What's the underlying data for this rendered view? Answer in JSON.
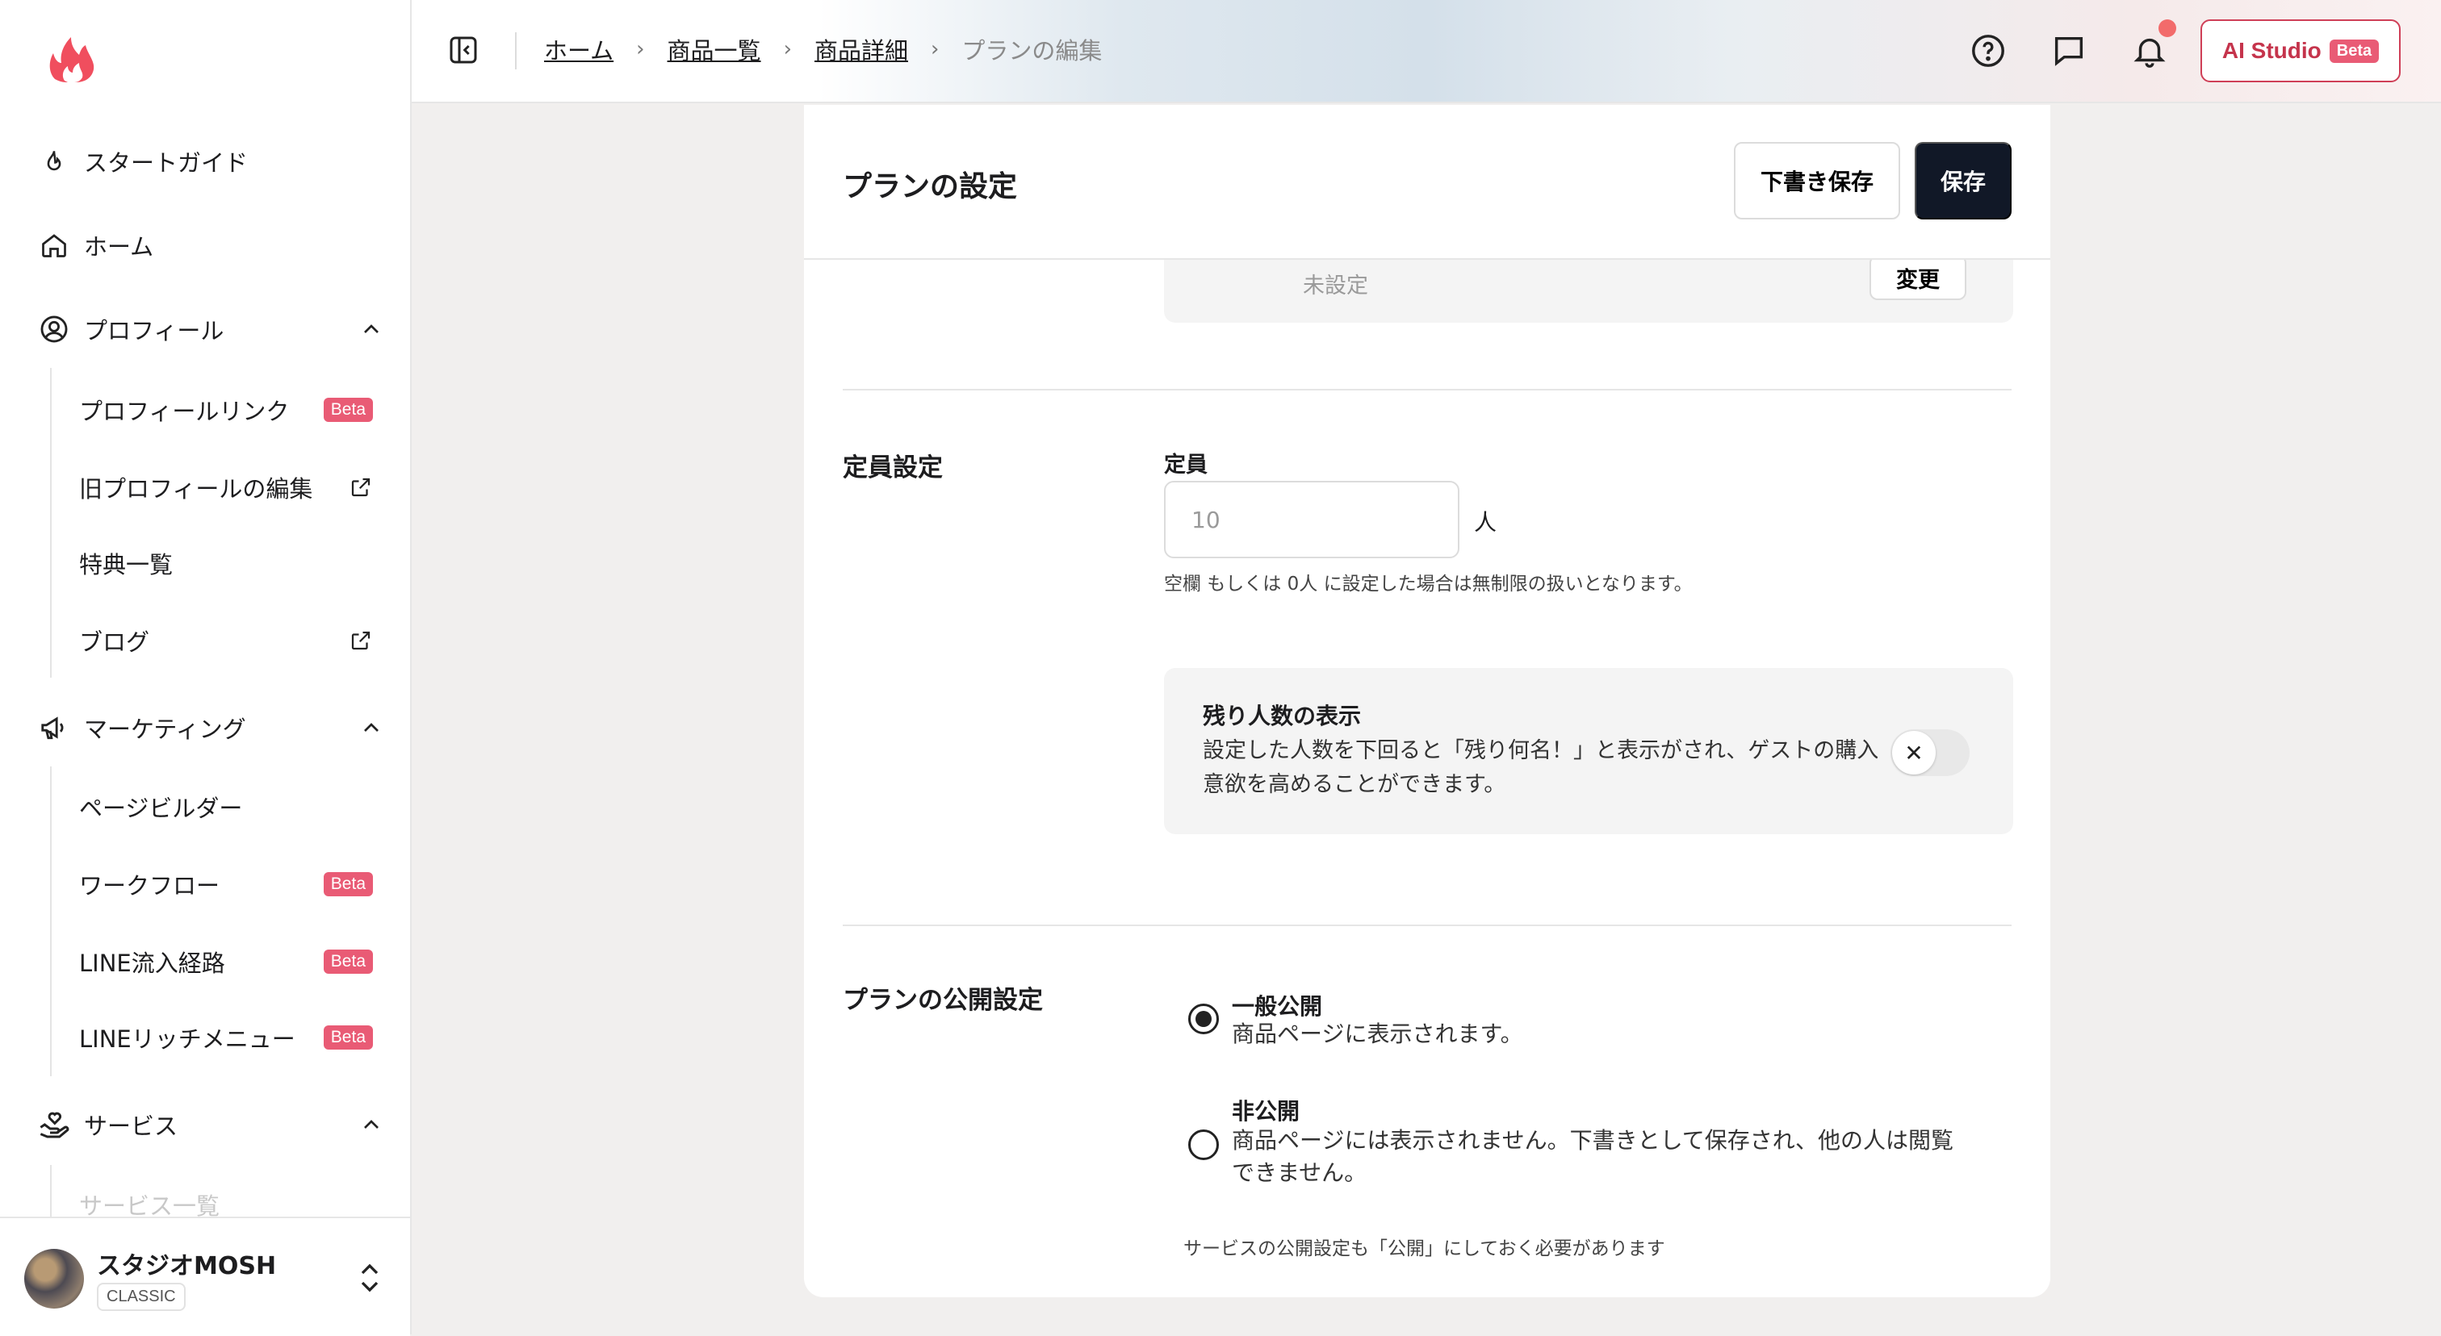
{
  "sidebar": {
    "items": [
      {
        "label": "スタートガイド",
        "icon": "flame-icon"
      },
      {
        "label": "ホーム",
        "icon": "home-icon"
      },
      {
        "label": "プロフィール",
        "icon": "user-circle-icon"
      },
      {
        "label": "マーケティング",
        "icon": "megaphone-icon"
      },
      {
        "label": "サービス",
        "icon": "hand-heart-icon"
      }
    ],
    "profile_sub": [
      {
        "label": "プロフィールリンク",
        "badge": "Beta"
      },
      {
        "label": "旧プロフィールの編集",
        "icon": "external-link-icon"
      },
      {
        "label": "特典一覧"
      },
      {
        "label": "ブログ",
        "icon": "external-link-icon"
      }
    ],
    "marketing_sub": [
      {
        "label": "ページビルダー"
      },
      {
        "label": "ワークフロー",
        "badge": "Beta"
      },
      {
        "label": "LINE流入経路",
        "badge": "Beta"
      },
      {
        "label": "LINEリッチメニュー",
        "badge": "Beta"
      }
    ],
    "service_sub": [
      {
        "label": "サービス一覧"
      }
    ],
    "user": {
      "name": "スタジオMOSH",
      "plan": "CLASSIC"
    }
  },
  "header": {
    "breadcrumb": [
      "ホーム",
      "商品一覧",
      "商品詳細"
    ],
    "breadcrumb_current": "プランの編集",
    "ai_studio_label": "AI Studio",
    "ai_studio_badge": "Beta"
  },
  "card": {
    "title": "プランの設定",
    "draft_label": "下書き保存",
    "save_label": "保存",
    "prev": {
      "value": "未設定",
      "change_label": "変更"
    }
  },
  "capacity": {
    "section_label": "定員設定",
    "field_label": "定員",
    "placeholder": "10",
    "unit": "人",
    "help": "空欄 もしくは 0人 に設定した場合は無制限の扱いとなります。",
    "remain_title": "残り人数の表示",
    "remain_desc": "設定した人数を下回ると「残り何名！」と表示がされ、ゲストの購入意欲を高めることができます。",
    "remain_toggle_on": false
  },
  "visibility": {
    "section_label": "プランの公開設定",
    "options": [
      {
        "title": "一般公開",
        "desc": "商品ページに表示されます。",
        "checked": true
      },
      {
        "title": "非公開",
        "desc": "商品ページには表示されません。下書きとして保存され、他の人は閲覧できません。",
        "checked": false
      }
    ],
    "note": "サービスの公開設定も「公開」にしておく必要があります"
  },
  "colors": {
    "accent": "#e95b75",
    "primary_button": "#111827",
    "ai_border": "#cf3f57"
  }
}
